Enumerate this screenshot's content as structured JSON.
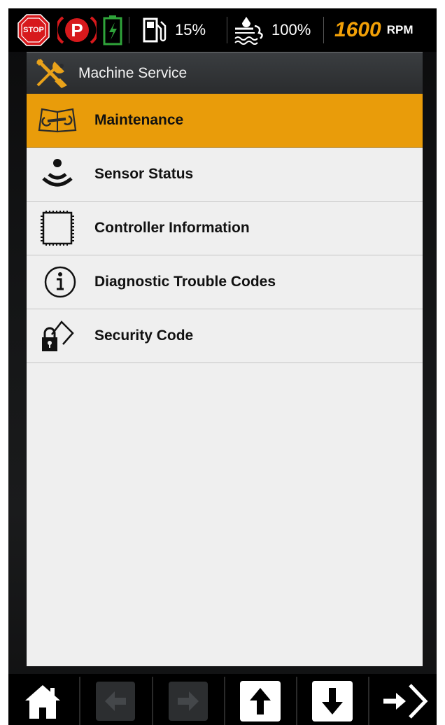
{
  "status_bar": {
    "stop_label": "STOP",
    "park_label": "P",
    "fuel_percent": "15%",
    "def_percent": "100%",
    "rpm_value": "1600",
    "rpm_unit": "RPM"
  },
  "panel": {
    "title": "Machine Service",
    "items": [
      {
        "label": "Maintenance",
        "icon": "manual-wrench-icon",
        "selected": true
      },
      {
        "label": "Sensor Status",
        "icon": "sensor-icon",
        "selected": false
      },
      {
        "label": "Controller Information",
        "icon": "chip-icon",
        "selected": false
      },
      {
        "label": "Diagnostic Trouble Codes",
        "icon": "info-icon",
        "selected": false
      },
      {
        "label": "Security Code",
        "icon": "lock-key-icon",
        "selected": false
      }
    ]
  },
  "bottom_bar": {
    "buttons": [
      "home-icon",
      "arrow-left-icon",
      "arrow-right-icon",
      "arrow-up-icon",
      "arrow-down-icon",
      "exit-icon"
    ]
  },
  "colors": {
    "accent": "#e99c0a",
    "stop_red": "#d7191c",
    "battery_green": "#2fa43a",
    "rpm_orange": "#f2a007"
  }
}
